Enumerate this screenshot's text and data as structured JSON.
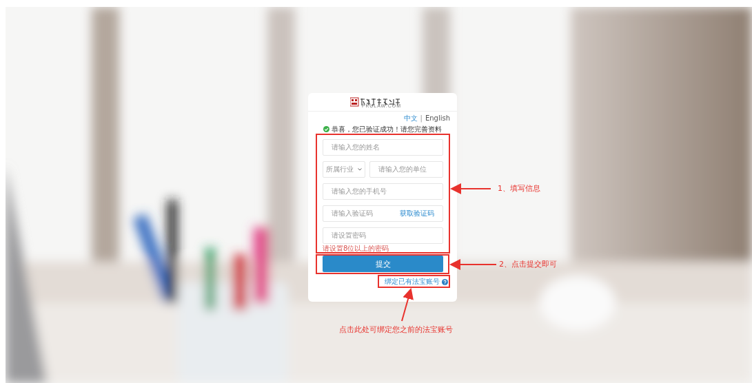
{
  "logo": {
    "domain": "PKULAW.COM"
  },
  "languages": [
    {
      "label": "中文",
      "selected": true
    },
    {
      "label": "English",
      "selected": false
    }
  ],
  "language_separator": "|",
  "success_message": "恭喜，您已验证成功！请您完善资料",
  "fields": [
    {
      "kind": "input",
      "placeholder": "请输入您的姓名"
    },
    {
      "kind": "select_input",
      "select": "所属行业",
      "placeholder": "请输入您的单位"
    },
    {
      "kind": "input",
      "placeholder": "请输入您的手机号"
    },
    {
      "kind": "code",
      "placeholder": "请输入验证码",
      "button": "获取验证码"
    },
    {
      "kind": "input",
      "placeholder": "请设置密码"
    }
  ],
  "password_hint": "请设置8位以上的密码",
  "submit_button": "提交",
  "bind_link": "绑定已有法宝账号",
  "annotations": [
    {
      "text": "1、填写信息"
    },
    {
      "text": "2、点击提交即可"
    },
    {
      "text": "点击此处可绑定您之前的法宝账号"
    }
  ]
}
